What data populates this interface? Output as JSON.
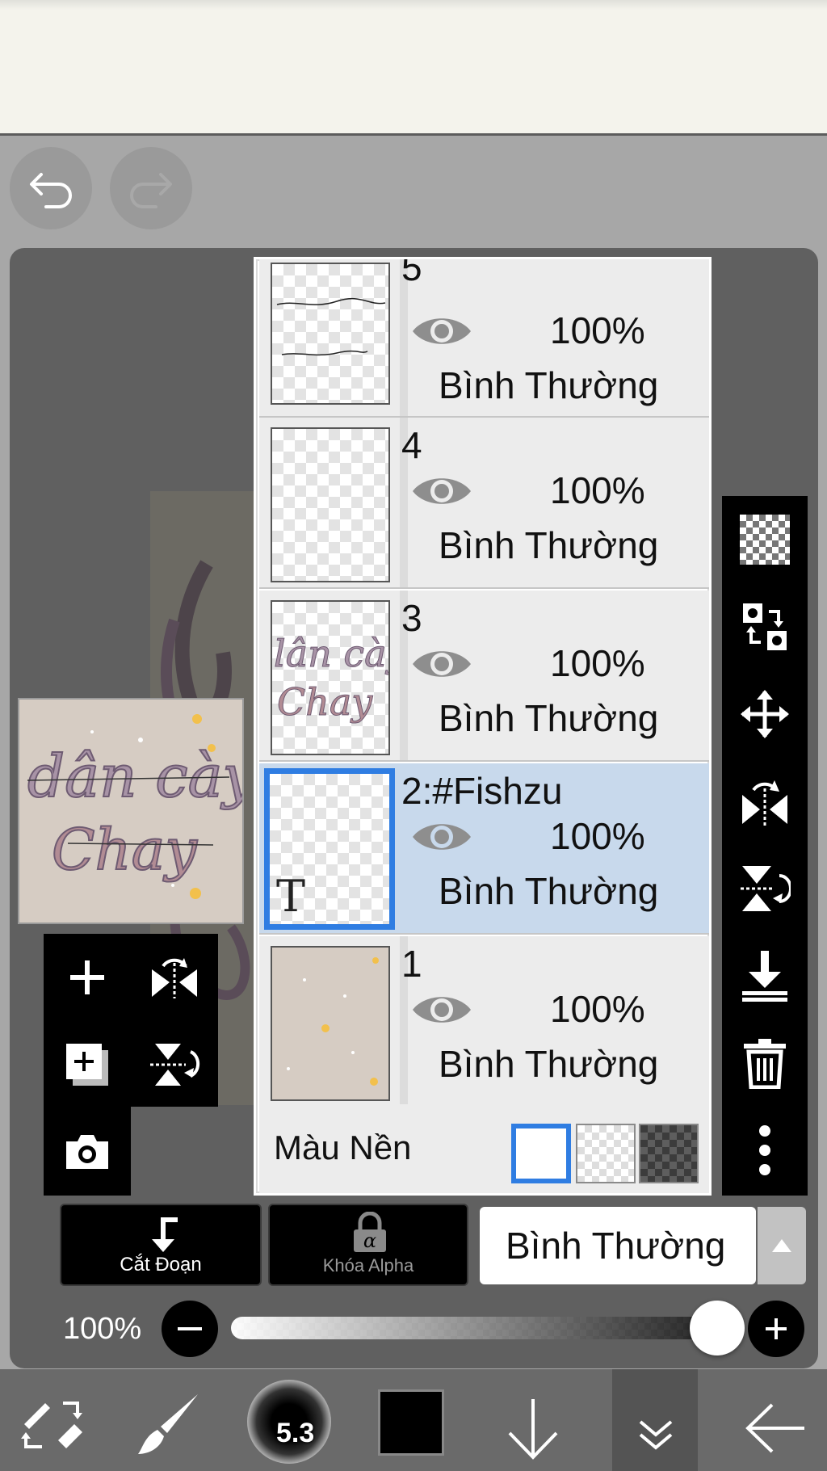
{
  "history": {
    "undo_icon": "undo-icon",
    "redo_icon": "redo-icon"
  },
  "layers": [
    {
      "name": "5",
      "opacity": "100%",
      "mode": "Bình Thường",
      "selected": false,
      "thumb": "sketch"
    },
    {
      "name": "4",
      "opacity": "100%",
      "mode": "Bình Thường",
      "selected": false,
      "thumb": "empty"
    },
    {
      "name": "3",
      "opacity": "100%",
      "mode": "Bình Thường",
      "selected": false,
      "thumb": "lettering"
    },
    {
      "name": "2:#Fishzu",
      "opacity": "100%",
      "mode": "Bình Thường",
      "selected": true,
      "thumb": "text",
      "thumb_glyph": "T"
    },
    {
      "name": "1",
      "opacity": "100%",
      "mode": "Bình Thường",
      "selected": false,
      "thumb": "background"
    }
  ],
  "background": {
    "label": "Màu Nền",
    "options": [
      "white",
      "transparent",
      "dark-checker"
    ],
    "selected": "white"
  },
  "controls": {
    "clipping_label": "Cắt Đoạn",
    "alpha_lock_label": "Khóa Alpha",
    "blend_mode": "Bình Thường",
    "opacity_label": "100%",
    "opacity_value": 1.0
  },
  "toolbar": {
    "brush_size": "5.3",
    "color": "#000000"
  },
  "colors": {
    "selection": "#2f7de2",
    "selected_row": "#c8d9ec",
    "panel_bg": "#606060"
  }
}
